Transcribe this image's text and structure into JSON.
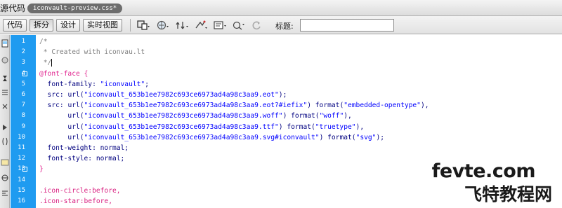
{
  "titlebar": {
    "source_label": "源代码",
    "file_tab": "iconvault-preview.css*"
  },
  "toolbar": {
    "view_buttons": [
      "代码",
      "拆分",
      "设计",
      "实时视图"
    ],
    "active_view": "拆分",
    "title_label": "标题:",
    "title_value": ""
  },
  "editor": {
    "line_numbers": [
      "1",
      "2",
      "3",
      "4",
      "5",
      "6",
      "7",
      "8",
      "9",
      "10",
      "11",
      "12",
      "13",
      "14",
      "15",
      "16"
    ],
    "lines": [
      [
        {
          "t": "/*",
          "c": "c-comment"
        }
      ],
      [
        {
          "t": " * Created with iconvau.lt",
          "c": "c-comment"
        }
      ],
      [
        {
          "t": " */",
          "c": "c-comment"
        }
      ],
      [
        {
          "t": "@font-face {",
          "c": "c-at"
        }
      ],
      [
        {
          "t": "  font-family: ",
          "c": "c-prop"
        },
        {
          "t": "\"iconvault\"",
          "c": "c-str"
        },
        {
          "t": ";",
          "c": "c-prop"
        }
      ],
      [
        {
          "t": "  src: ",
          "c": "c-prop"
        },
        {
          "t": "url(",
          "c": "c-fn"
        },
        {
          "t": "\"iconvault_653b1ee7982c693ce6973ad4a98c3aa9.eot\"",
          "c": "c-str"
        },
        {
          "t": ");",
          "c": "c-fn"
        }
      ],
      [
        {
          "t": "  src: ",
          "c": "c-prop"
        },
        {
          "t": "url(",
          "c": "c-fn"
        },
        {
          "t": "\"iconvault_653b1ee7982c693ce6973ad4a98c3aa9.eot?#iefix\"",
          "c": "c-str"
        },
        {
          "t": ") format(",
          "c": "c-fn"
        },
        {
          "t": "\"embedded-opentype\"",
          "c": "c-str"
        },
        {
          "t": "),",
          "c": "c-fn"
        }
      ],
      [
        {
          "t": "       url(",
          "c": "c-fn"
        },
        {
          "t": "\"iconvault_653b1ee7982c693ce6973ad4a98c3aa9.woff\"",
          "c": "c-str"
        },
        {
          "t": ") format(",
          "c": "c-fn"
        },
        {
          "t": "\"woff\"",
          "c": "c-str"
        },
        {
          "t": "),",
          "c": "c-fn"
        }
      ],
      [
        {
          "t": "       url(",
          "c": "c-fn"
        },
        {
          "t": "\"iconvault_653b1ee7982c693ce6973ad4a98c3aa9.ttf\"",
          "c": "c-str"
        },
        {
          "t": ") format(",
          "c": "c-fn"
        },
        {
          "t": "\"truetype\"",
          "c": "c-str"
        },
        {
          "t": "),",
          "c": "c-fn"
        }
      ],
      [
        {
          "t": "       url(",
          "c": "c-fn"
        },
        {
          "t": "\"iconvault_653b1ee7982c693ce6973ad4a98c3aa9.svg#iconvault\"",
          "c": "c-str"
        },
        {
          "t": ") format(",
          "c": "c-fn"
        },
        {
          "t": "\"svg\"",
          "c": "c-str"
        },
        {
          "t": ");",
          "c": "c-fn"
        }
      ],
      [
        {
          "t": "  font-weight: normal;",
          "c": "c-prop"
        }
      ],
      [
        {
          "t": "  font-style: normal;",
          "c": "c-prop"
        }
      ],
      [
        {
          "t": "}",
          "c": "c-at"
        }
      ],
      [],
      [
        {
          "t": ".icon-circle:before,",
          "c": "c-sel"
        }
      ],
      [
        {
          "t": ".icon-star:before,",
          "c": "c-sel"
        }
      ]
    ],
    "cursor_line": 3
  },
  "watermark": {
    "en": "fevte.com",
    "cn": "飞特教程网"
  },
  "colors": {
    "gutter": "#1f9bf0",
    "comment": "#808080",
    "selector": "#d81e7f",
    "string": "#0000ff"
  }
}
